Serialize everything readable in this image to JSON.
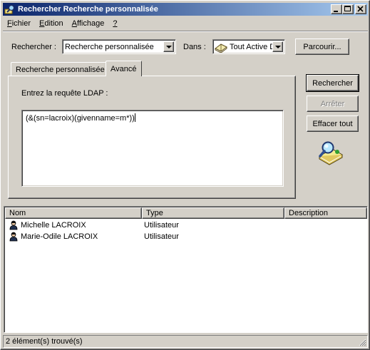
{
  "window": {
    "title": "Rechercher Recherche personnalisée"
  },
  "title_buttons": {
    "minimize": "_",
    "maximize": "□",
    "close": "×"
  },
  "menu": [
    {
      "label": "Fichier",
      "accel": "F",
      "rest": "ichier"
    },
    {
      "label": "Edition",
      "accel": "E",
      "rest": "dition"
    },
    {
      "label": "Affichage",
      "accel": "A",
      "rest": "ffichage"
    },
    {
      "label": "?",
      "accel": "?",
      "rest": ""
    }
  ],
  "search": {
    "find_label": "Rechercher :",
    "find_value": "Recherche personnalisée",
    "in_label": "Dans :",
    "in_value": "Tout Active D",
    "browse_button": "Parcourir..."
  },
  "tabs": [
    {
      "label": "Recherche personnalisée",
      "active": false
    },
    {
      "label": "Avancé",
      "active": true
    }
  ],
  "advanced": {
    "ldap_label": "Entrez la requête LDAP :",
    "query": "(&(sn=lacroix)(givenname=m*))"
  },
  "actions": {
    "search": "Rechercher",
    "stop": "Arrêter",
    "clear": "Effacer tout"
  },
  "results": {
    "columns": [
      "Nom",
      "Type",
      "Description"
    ],
    "rows": [
      {
        "name": "Michelle LACROIX",
        "type": "Utilisateur",
        "description": ""
      },
      {
        "name": "Marie-Odile LACROIX",
        "type": "Utilisateur",
        "description": ""
      }
    ]
  },
  "status": "2 élément(s) trouvé(s)",
  "icons": {
    "app": "search-directory-icon",
    "directory_search": "magnifier-over-book-icon",
    "user": "user-icon",
    "directory": "directory-book-icon"
  },
  "colors": {
    "title_start": "#0a246a",
    "title_end": "#a6caf0",
    "face": "#d4d0c8"
  }
}
